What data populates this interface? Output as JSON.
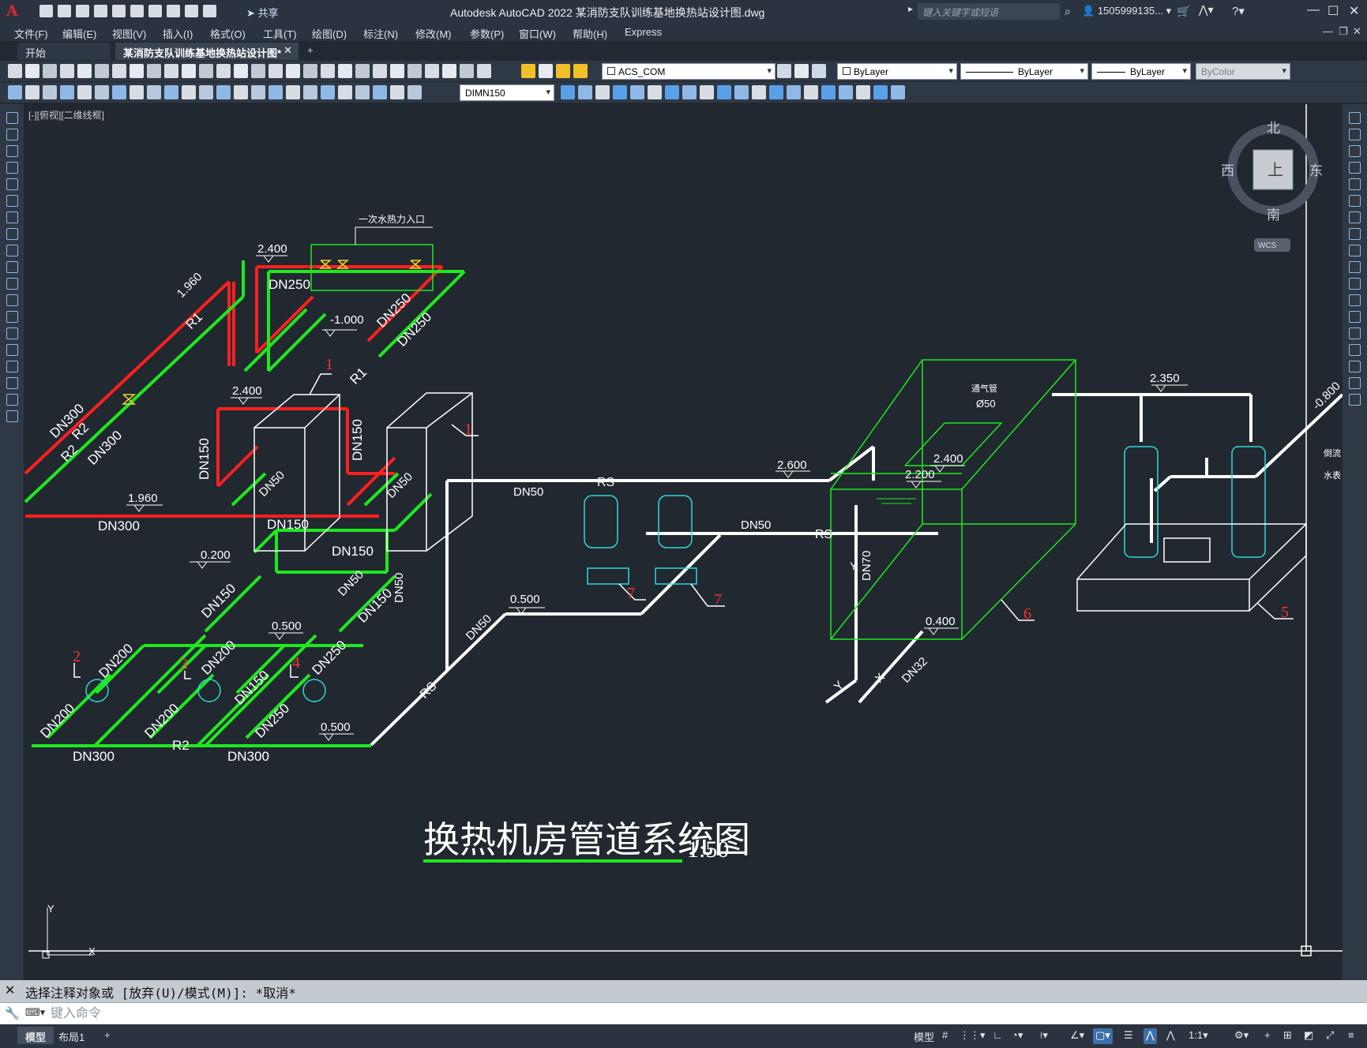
{
  "app": {
    "logo": "A",
    "share_label": "共享",
    "window_title": "Autodesk AutoCAD 2022    某消防支队训练基地换热站设计图.dwg",
    "search_placeholder": "键入关键字或短语",
    "user": "1505999135...",
    "window_controls": [
      "—",
      "☐",
      "✕"
    ]
  },
  "menu": {
    "items": [
      "文件(F)",
      "编辑(E)",
      "视图(V)",
      "插入(I)",
      "格式(O)",
      "工具(T)",
      "绘图(D)",
      "标注(N)",
      "修改(M)",
      "参数(P)",
      "窗口(W)",
      "帮助(H)",
      "Express"
    ],
    "doc_controls": [
      "—",
      "❐",
      "✕"
    ]
  },
  "tabs": {
    "start": "开始",
    "doc": "某消防支队训练基地换热站设计图*",
    "close": "✕",
    "add": "+"
  },
  "toolbar": {
    "layer": "ACS_COM",
    "color": "ByLayer",
    "linetype": "ByLayer",
    "lineweight": "ByLayer",
    "plotstyle": "ByColor",
    "dimstyle": "DIMN150"
  },
  "viewport": {
    "label": "[-][俯视][二维线框]",
    "viewcube": {
      "north": "北",
      "south": "南",
      "east": "东",
      "west": "西",
      "face": "上",
      "wcs": "WCS"
    },
    "ucs": {
      "y": "Y",
      "x": "X"
    },
    "drawing": {
      "title": "换热机房管道系统图",
      "scale": "1:50",
      "inlet_note": "一次水热力入口",
      "vent_note": "通气管",
      "vent_size": "Ø50",
      "right_notes": [
        "-0.800",
        "倒流",
        "水表"
      ],
      "pipe_labels": [
        "DN250",
        "DN250",
        "DN250",
        "DN300",
        "DN300",
        "DN300",
        "DN300",
        "DN300",
        "DN150",
        "DN150",
        "DN150",
        "DN150",
        "DN150",
        "DN150",
        "DN150",
        "DN50",
        "DN50",
        "DN50",
        "DN50",
        "DN50",
        "DN50",
        "DN50",
        "DN200",
        "DN200",
        "DN200",
        "DN200",
        "DN250",
        "DN250",
        "DN70",
        "DN32"
      ],
      "flow_labels": [
        "R1",
        "R1",
        "R2",
        "R2",
        "R2",
        "RS",
        "RS",
        "RS",
        "Y",
        "Y",
        "X"
      ],
      "elevations": [
        "2.400",
        "2.400",
        "1.960",
        "1.960",
        "-1.000",
        "0.200",
        "0.500",
        "0.500",
        "0.500",
        "2.600",
        "2.400",
        "2.200",
        "0.400",
        "2.350"
      ],
      "equipment_tags": [
        "1",
        "1",
        "2",
        "3",
        "4",
        "5",
        "6",
        "7",
        "7"
      ]
    }
  },
  "command": {
    "history": "选择注释对象或 [放弃(U)/模式(M)]: *取消*",
    "close": "✕",
    "placeholder": "键入命令"
  },
  "status": {
    "layout_tabs": [
      "模型",
      "布局1"
    ],
    "add": "+",
    "model": "模型",
    "scale": "1:1"
  },
  "colors": {
    "supply": "#ff1f1f",
    "return": "#1fe81f",
    "white_line": "#ffffff",
    "equipment": "#2fd8d8",
    "tags": "#ff3030",
    "accent": "#3d6fa8"
  }
}
